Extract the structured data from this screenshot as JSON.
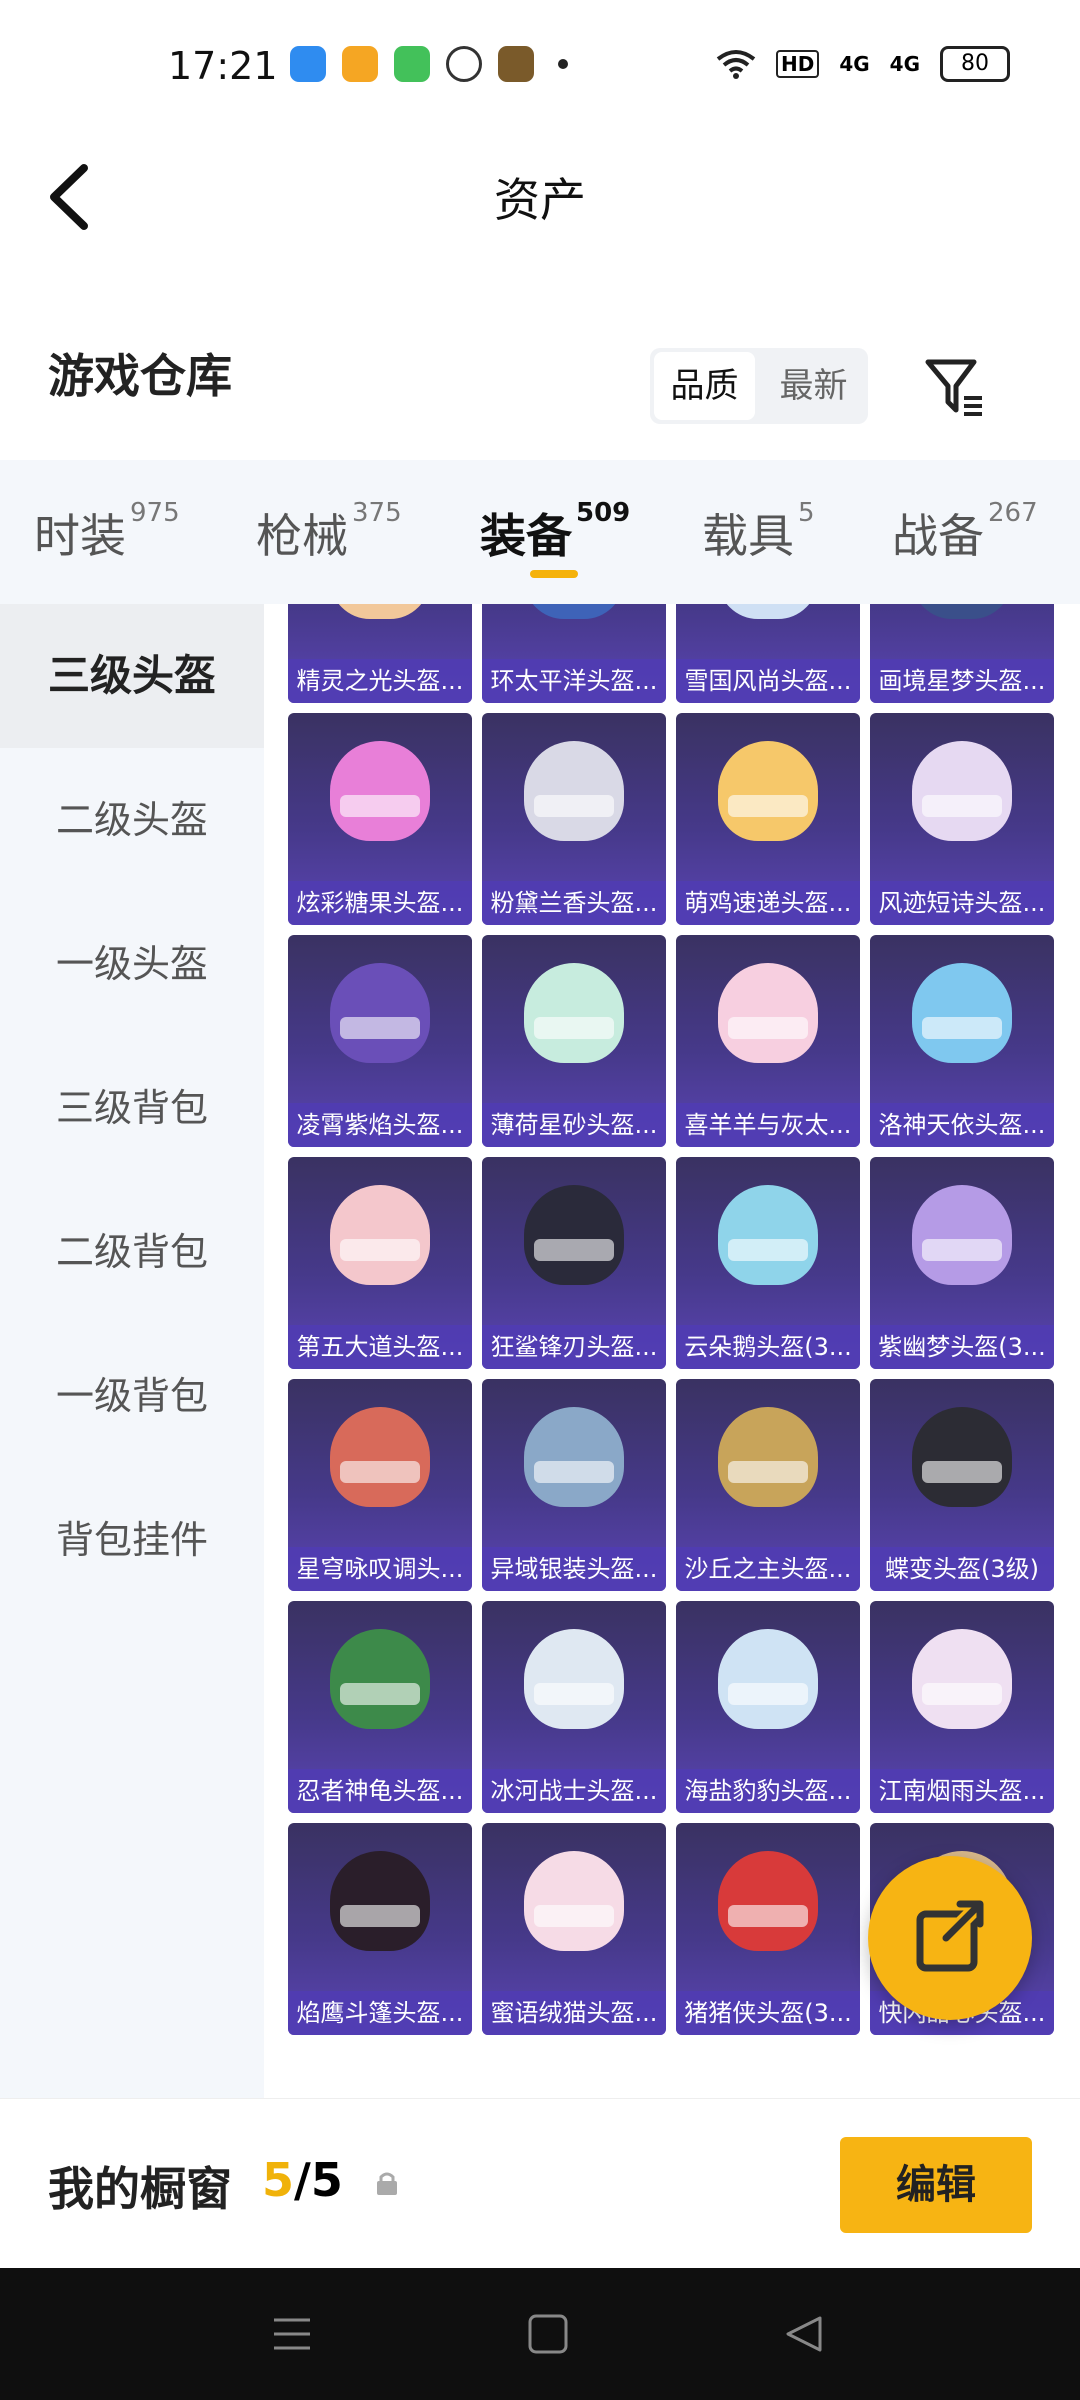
{
  "status_bar": {
    "time": "17:21",
    "battery": "80",
    "network": [
      "HD",
      "4G",
      "4G"
    ]
  },
  "header": {
    "title": "资产"
  },
  "warehouse": {
    "title": "游戏仓库",
    "sort_options": [
      "品质",
      "最新"
    ],
    "active_sort": "品质"
  },
  "categories": [
    {
      "label": "时装",
      "count": "975"
    },
    {
      "label": "枪械",
      "count": "375"
    },
    {
      "label": "装备",
      "count": "509"
    },
    {
      "label": "载具",
      "count": "5"
    },
    {
      "label": "战备",
      "count": "267"
    }
  ],
  "sidebar": {
    "items": [
      "三级头盔",
      "二级头盔",
      "一级头盔",
      "三级背包",
      "二级背包",
      "一级背包",
      "背包挂件"
    ]
  },
  "grid": {
    "items": [
      "精灵之光头盔...",
      "环太平洋头盔...",
      "雪国风尚头盔...",
      "画境星梦头盔...",
      "炫彩糖果头盔...",
      "粉黛兰香头盔...",
      "萌鸡速递头盔...",
      "风迹短诗头盔...",
      "凌霄紫焰头盔...",
      "薄荷星砂头盔...",
      "喜羊羊与灰太...",
      "洛神天依头盔...",
      "第五大道头盔...",
      "狂鲨锋刃头盔...",
      "云朵鹅头盔(3...",
      "紫幽梦头盔(3...",
      "星穹咏叹调头...",
      "异域银装头盔...",
      "沙丘之主头盔...",
      "蝶变头盔(3级)",
      "忍者神龟头盔...",
      "冰河战士头盔...",
      "海盐豹豹头盔...",
      "江南烟雨头盔...",
      "焰鹰斗篷头盔...",
      "蜜语绒猫头盔...",
      "猪猪侠头盔(3...",
      "快闪甜心头盔..."
    ]
  },
  "bottom_bar": {
    "title": "我的橱窗",
    "current": "5",
    "total": "5",
    "edit_label": "编辑"
  },
  "colors": {
    "accent": "#f7b413",
    "card_bg": "#46398a",
    "label_bg": "#503cb4"
  }
}
